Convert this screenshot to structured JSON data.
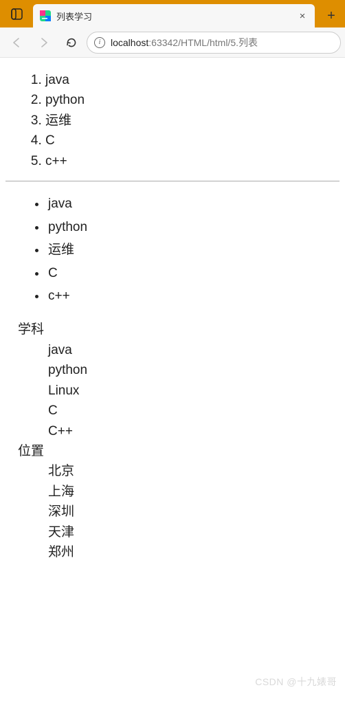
{
  "browser": {
    "tab": {
      "title": "列表学习"
    },
    "addressbar": {
      "host": "localhost",
      "path": ":63342/HTML/html/5.列表"
    }
  },
  "content": {
    "ordered_list": [
      "java",
      "python",
      "运维",
      "C",
      "c++"
    ],
    "unordered_list": [
      "java",
      "python",
      "运维",
      "C",
      "c++"
    ],
    "definition_list": [
      {
        "term": "学科",
        "defs": [
          "java",
          "python",
          "Linux",
          "C",
          "C++"
        ]
      },
      {
        "term": "位置",
        "defs": [
          "北京",
          "上海",
          "深圳",
          "天津",
          "郑州"
        ]
      }
    ]
  },
  "watermark": "CSDN @十九婊哥"
}
